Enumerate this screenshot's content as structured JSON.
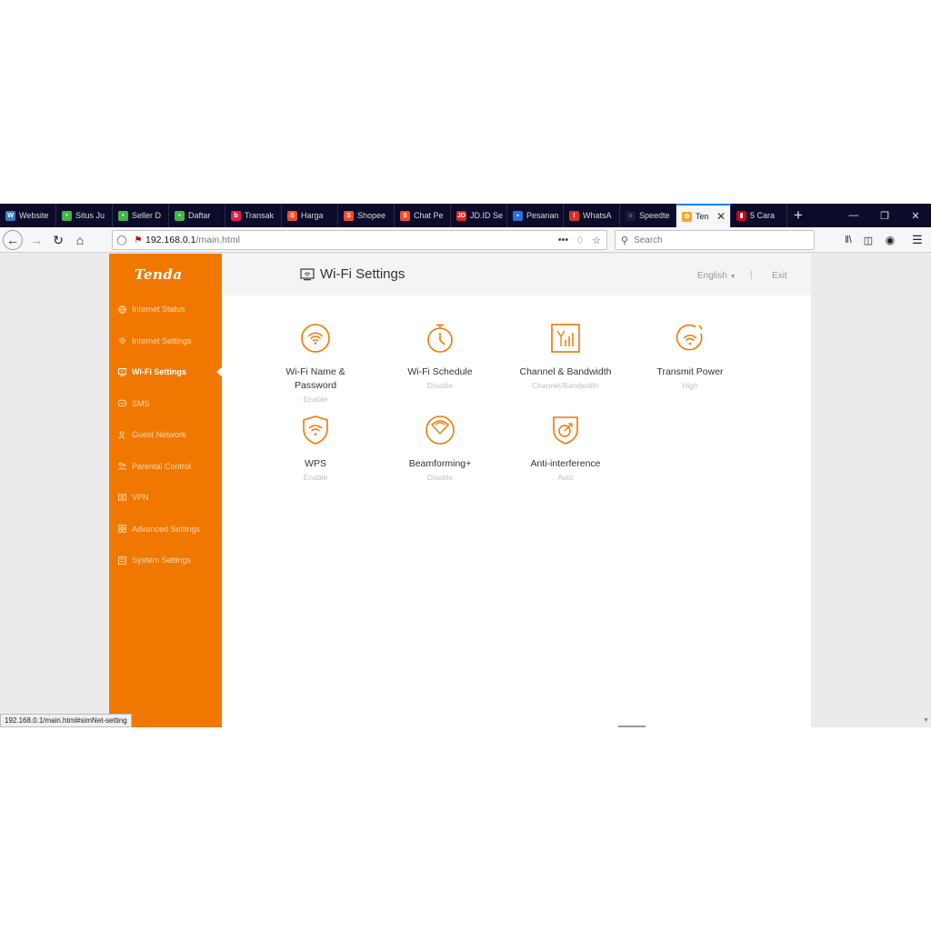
{
  "browser": {
    "tabs": [
      {
        "label": "Website",
        "icon": "website-icon",
        "color": "#3d7cc9",
        "glyph": "W"
      },
      {
        "label": "Situs Ju",
        "icon": "tokopedia-icon",
        "color": "#42b549",
        "glyph": "•"
      },
      {
        "label": "Seller D",
        "icon": "tokopedia-icon",
        "color": "#42b549",
        "glyph": "•"
      },
      {
        "label": "Daftar",
        "icon": "tokopedia-icon",
        "color": "#42b549",
        "glyph": "•"
      },
      {
        "label": "Transak",
        "icon": "bukalapak-icon",
        "color": "#e31e52",
        "glyph": "b"
      },
      {
        "label": "Harga",
        "icon": "shopee-icon",
        "color": "#ee4d2d",
        "glyph": "S"
      },
      {
        "label": "Shopee",
        "icon": "shopee-icon",
        "color": "#ee4d2d",
        "glyph": "S"
      },
      {
        "label": "Chat Pe",
        "icon": "shopee-icon",
        "color": "#ee4d2d",
        "glyph": "S"
      },
      {
        "label": "JD.ID Se",
        "icon": "jd-icon",
        "color": "#e1251b",
        "glyph": "JD"
      },
      {
        "label": "Pesanan",
        "icon": "document-icon",
        "color": "#2e6fd8",
        "glyph": "▪"
      },
      {
        "label": "WhatsA",
        "icon": "whatsapp-icon",
        "color": "#d93025",
        "glyph": "!"
      },
      {
        "label": "Speedte",
        "icon": "speedtest-icon",
        "color": "#1b1b3a",
        "glyph": "○"
      },
      {
        "label": "Ten",
        "icon": "tenda-icon",
        "color": "#f5a623",
        "glyph": "✿",
        "active": true
      },
      {
        "label": "5 Cara",
        "icon": "bookmark-icon",
        "color": "#d0021b",
        "glyph": "▮"
      }
    ],
    "url_host": "192.168.0.1",
    "url_path": "/main.html",
    "search_placeholder": "Search",
    "status_url": "192.168.0.1/main.html#simNet-setting"
  },
  "sidebar": {
    "logo": "Tenda",
    "items": [
      {
        "label": "Internet Status",
        "icon": "globe-icon"
      },
      {
        "label": "Internet Settings",
        "icon": "gear-icon"
      },
      {
        "label": "Wi-Fi Settings",
        "icon": "wifi-monitor-icon",
        "active": true
      },
      {
        "label": "SMS",
        "icon": "message-icon"
      },
      {
        "label": "Guest Network",
        "icon": "guest-icon"
      },
      {
        "label": "Parental Control",
        "icon": "parental-icon"
      },
      {
        "label": "VPN",
        "icon": "vpn-icon"
      },
      {
        "label": "Advanced Settings",
        "icon": "grid-icon"
      },
      {
        "label": "System Settings",
        "icon": "system-icon"
      }
    ]
  },
  "header": {
    "title": "Wi-Fi Settings",
    "language": "English",
    "separator": "|",
    "exit": "Exit"
  },
  "cards": [
    {
      "label": "Wi-Fi Name &\nPassword",
      "status": "Enable",
      "icon": "wifi-circle-icon"
    },
    {
      "label": "Wi-Fi Schedule",
      "status": "Disable",
      "icon": "stopwatch-icon"
    },
    {
      "label": "Channel & Bandwidth",
      "status": "Channel/Bandwidth",
      "icon": "signal-bars-icon"
    },
    {
      "label": "Transmit Power",
      "status": "High",
      "icon": "wifi-power-icon"
    },
    {
      "label": "WPS",
      "status": "Enable",
      "icon": "shield-wifi-icon"
    },
    {
      "label": "Beamforming+",
      "status": "Disable",
      "icon": "beamforming-icon"
    },
    {
      "label": "Anti-interference",
      "status": "Auto",
      "icon": "shield-check-icon"
    }
  ],
  "colors": {
    "accent": "#f07800",
    "tab_bg": "#0c0c2a"
  }
}
